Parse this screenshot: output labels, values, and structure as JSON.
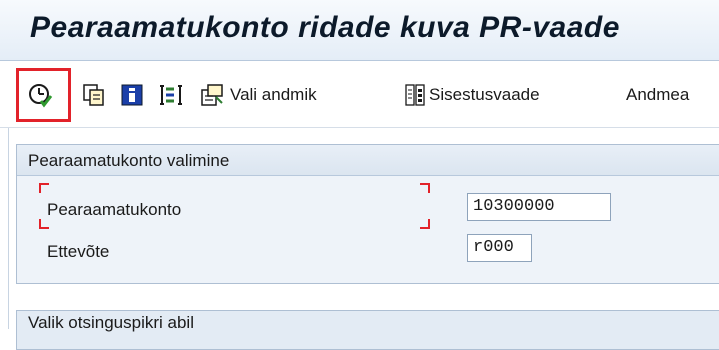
{
  "window": {
    "title": "Pearaamatukonto ridade kuva PR-vaade"
  },
  "toolbar": {
    "execute_icon": "clock-check-icon",
    "copy_icon": "copy-icon",
    "info_icon": "info-icon",
    "selection_icon": "selection-icon",
    "select_data_label": "Vali andmik",
    "entry_view_label": "Sisestusvaade",
    "more_label": "Andmea"
  },
  "selection_group": {
    "title": "Pearaamatukonto valimine",
    "fields": [
      {
        "label": "Pearaamatukonto",
        "value": "10300000"
      },
      {
        "label": "Ettevõte",
        "value": "r000"
      }
    ]
  },
  "search_group": {
    "title": "Valik otsinguspikri abil"
  },
  "colors": {
    "highlight": "#e2222a",
    "title_bg": "#e4edf7",
    "group_bg": "#eef3f9"
  }
}
